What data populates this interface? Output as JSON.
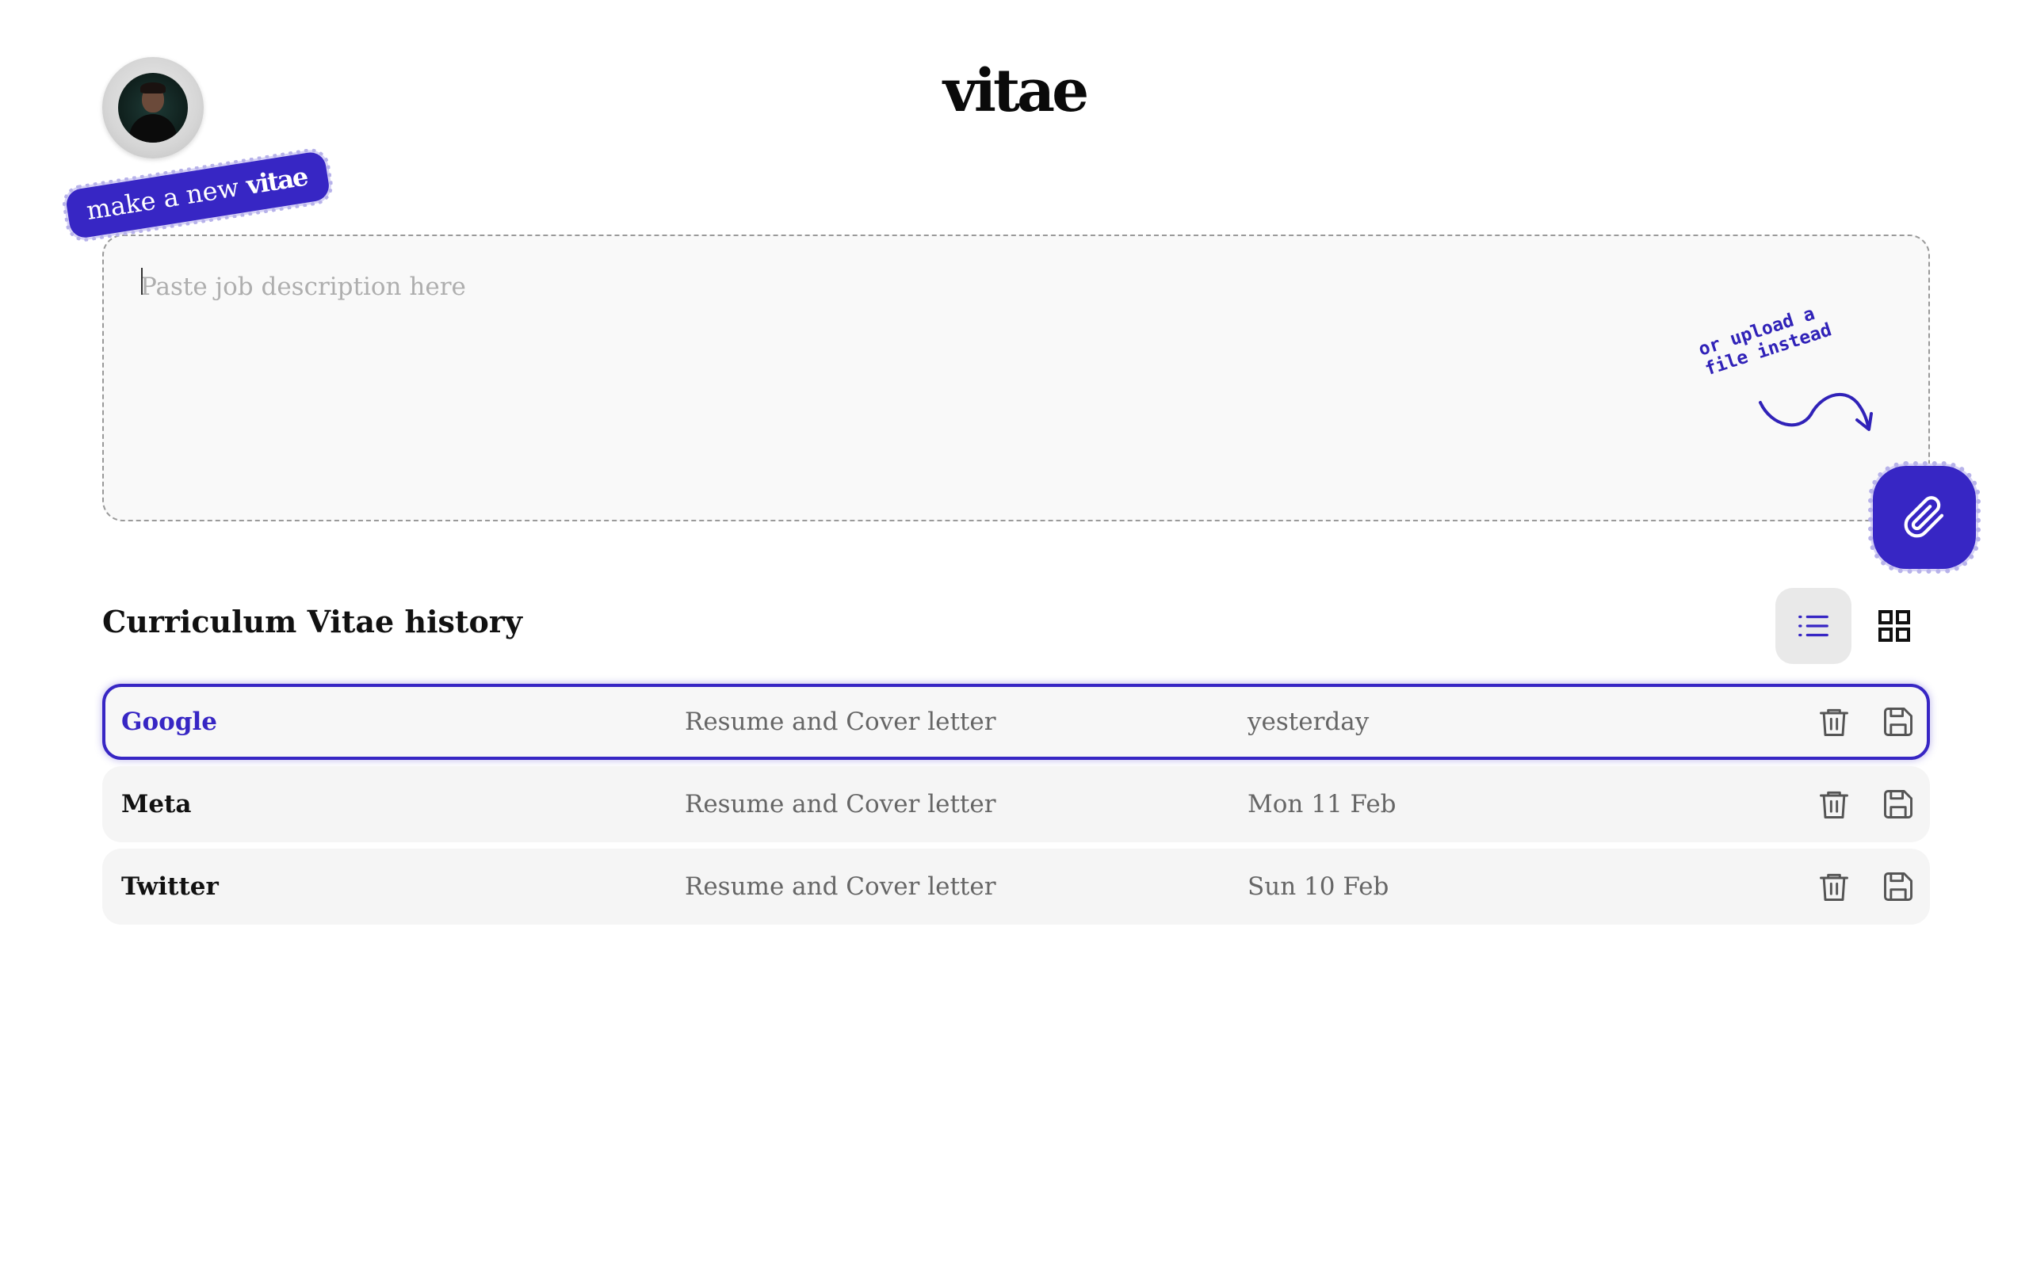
{
  "header": {
    "logo": "vitae",
    "avatar_icon": "user-avatar"
  },
  "new_vitae": {
    "sticker_prefix": "make a new",
    "sticker_brand": "vitae",
    "placeholder": "Paste job description here",
    "value": "",
    "note_line1": "or upload a",
    "note_line2": "file instead",
    "attach_icon": "paperclip-icon"
  },
  "history": {
    "title": "Curriculum Vitae history",
    "view_list_icon": "list-icon",
    "view_grid_icon": "grid-icon",
    "active_view": "list",
    "rows": [
      {
        "company": "Google",
        "type": "Resume and Cover letter",
        "date": "yesterday",
        "active": true
      },
      {
        "company": "Meta",
        "type": "Resume and Cover letter",
        "date": "Mon 11 Feb",
        "active": false
      },
      {
        "company": "Twitter",
        "type": "Resume and Cover letter",
        "date": "Sun 10 Feb",
        "active": false
      }
    ],
    "row_actions": [
      "trash-icon",
      "save-icon"
    ]
  },
  "colors": {
    "accent": "#3726c4",
    "row_bg": "#f5f5f5",
    "muted_text": "#666666"
  }
}
